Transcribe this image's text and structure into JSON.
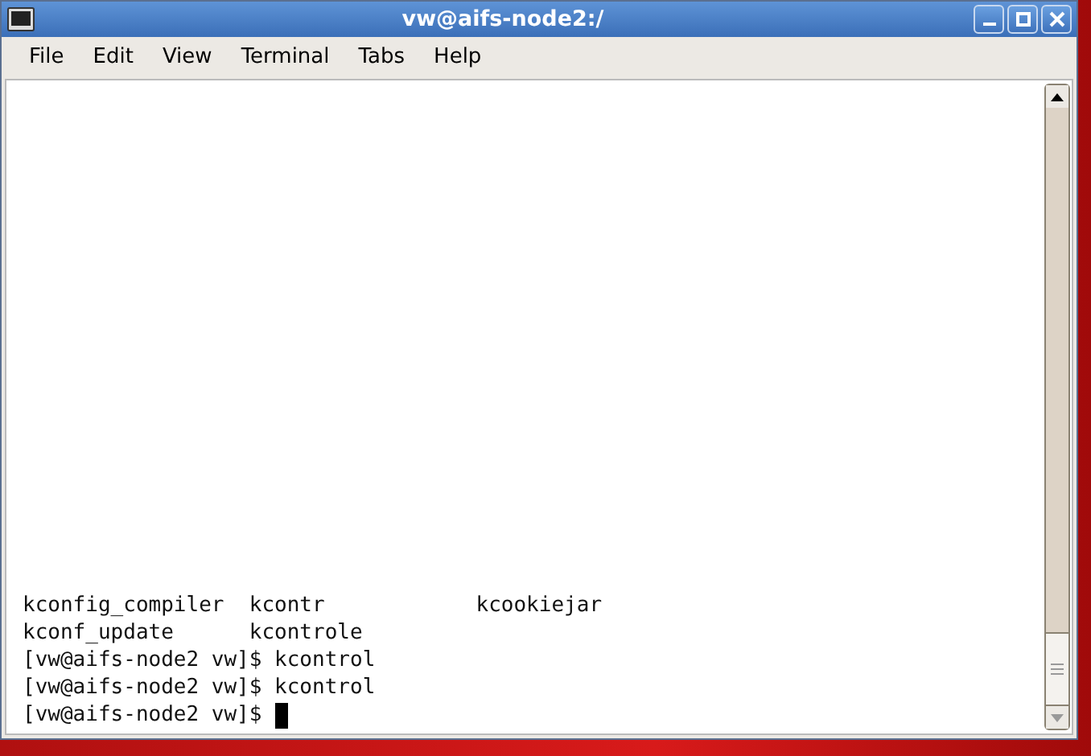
{
  "window": {
    "title": "vw@aifs-node2:/"
  },
  "menu": [
    "File",
    "Edit",
    "View",
    "Terminal",
    "Tabs",
    "Help"
  ],
  "terminal": {
    "lines": [
      {
        "cells": [
          "kconfig_compiler",
          "kcontr",
          "kcookiejar"
        ]
      },
      {
        "cells": [
          "kconf_update",
          "kcontrole"
        ]
      },
      {
        "cells": [
          "[vw@aifs-node2 vw]$ kcontrol"
        ]
      },
      {
        "cells": [
          "[vw@aifs-node2 vw]$ kcontrol"
        ]
      },
      {
        "cells": [
          "[vw@aifs-node2 vw]$"
        ],
        "cursor": true
      }
    ]
  }
}
